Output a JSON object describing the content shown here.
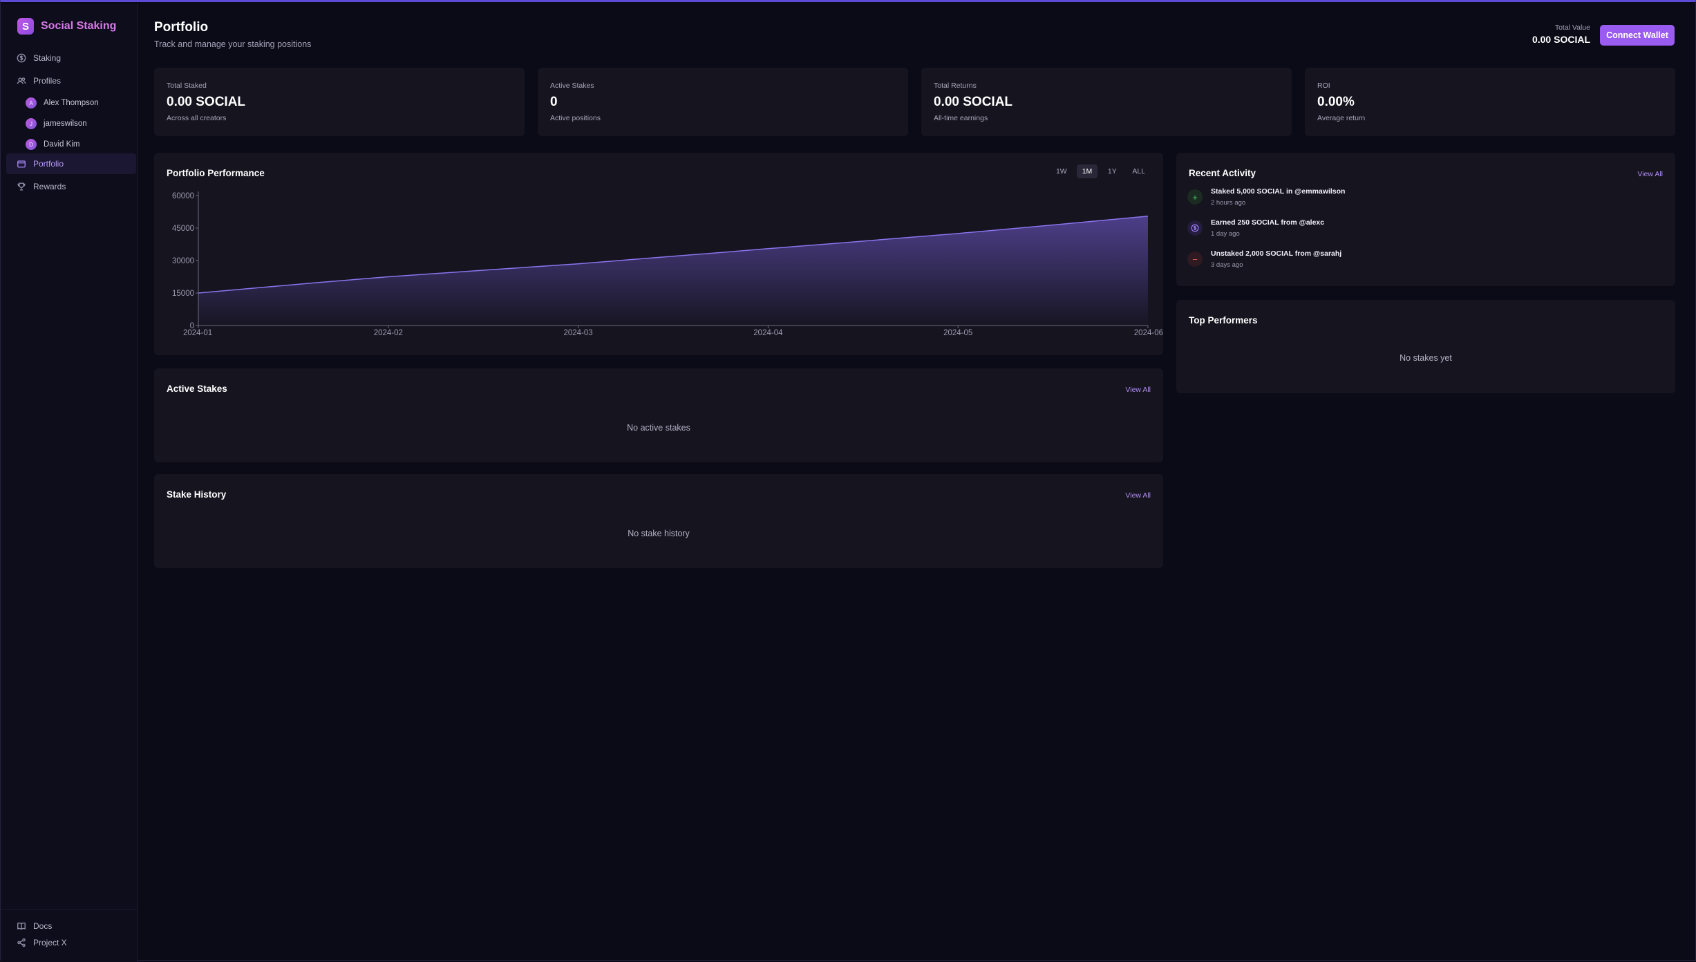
{
  "app": {
    "name": "Social Staking",
    "logo_letter": "S"
  },
  "sidebar": {
    "items": [
      {
        "label": "Staking",
        "icon": "dollar-circle-icon"
      },
      {
        "label": "Profiles",
        "icon": "users-icon"
      },
      {
        "label": "Portfolio",
        "icon": "wallet-icon",
        "active": true
      },
      {
        "label": "Rewards",
        "icon": "trophy-icon"
      }
    ],
    "profiles": [
      {
        "name": "Alex Thompson",
        "initial": "A"
      },
      {
        "name": "jameswilson",
        "initial": "J"
      },
      {
        "name": "David Kim",
        "initial": "D"
      }
    ],
    "bottom": [
      {
        "label": "Docs",
        "icon": "book-icon"
      },
      {
        "label": "Project X",
        "icon": "share-icon"
      }
    ]
  },
  "header": {
    "title": "Portfolio",
    "subtitle": "Track and manage your staking positions",
    "total_value_label": "Total Value",
    "total_value": "0.00 SOCIAL",
    "connect_label": "Connect Wallet"
  },
  "stats": [
    {
      "label": "Total Staked",
      "value": "0.00 SOCIAL",
      "sub": "Across all creators"
    },
    {
      "label": "Active Stakes",
      "value": "0",
      "sub": "Active positions"
    },
    {
      "label": "Total Returns",
      "value": "0.00 SOCIAL",
      "sub": "All-time earnings"
    },
    {
      "label": "ROI",
      "value": "0.00%",
      "sub": "Average return"
    }
  ],
  "performance": {
    "title": "Portfolio Performance",
    "ranges": [
      "1W",
      "1M",
      "1Y",
      "ALL"
    ],
    "active_range": "1M"
  },
  "chart_data": {
    "type": "area",
    "x": [
      "2024-01",
      "2024-02",
      "2024-03",
      "2024-04",
      "2024-05",
      "2024-06"
    ],
    "series": [
      {
        "values": [
          15000,
          22500,
          28500,
          35500,
          42500,
          50500
        ]
      }
    ],
    "y_ticks": [
      0,
      15000,
      30000,
      45000,
      60000
    ],
    "ylim": [
      0,
      60000
    ],
    "grid": false,
    "color": "#7b62e0"
  },
  "active_stakes": {
    "title": "Active Stakes",
    "view_all": "View All",
    "empty": "No active stakes"
  },
  "stake_history": {
    "title": "Stake History",
    "view_all": "View All",
    "empty": "No stake history"
  },
  "recent_activity": {
    "title": "Recent Activity",
    "view_all": "View All",
    "items": [
      {
        "text": "Staked 5,000 SOCIAL in @emmawilson",
        "time": "2 hours ago",
        "icon": "plus-icon",
        "color": "#3fbf6a",
        "bg": "#1b2b22"
      },
      {
        "text": "Earned 250 SOCIAL from @alexc",
        "time": "1 day ago",
        "icon": "dollar-circle-icon",
        "color": "#9a7cf0",
        "bg": "#241d3d"
      },
      {
        "text": "Unstaked 2,000 SOCIAL from @sarahj",
        "time": "3 days ago",
        "icon": "minus-icon",
        "color": "#e05a5a",
        "bg": "#2e1a20"
      }
    ]
  },
  "top_performers": {
    "title": "Top Performers",
    "empty": "No stakes yet"
  }
}
